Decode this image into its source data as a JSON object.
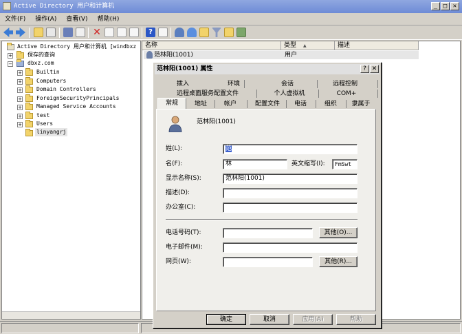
{
  "window": {
    "title": "Active Directory 用户和计算机"
  },
  "menu": [
    "文件(F)",
    "操作(A)",
    "查看(V)",
    "帮助(H)"
  ],
  "tree": {
    "root": "Active Directory 用户和计算机 [windbxz",
    "saved_queries": "保存的查询",
    "domain": "dbxz.com",
    "items": [
      "Builtin",
      "Computers",
      "Domain Controllers",
      "ForeignSecurityPrincipals",
      "Managed Service Accounts",
      "test",
      "Users",
      "linyangrj"
    ]
  },
  "list": {
    "columns": [
      "名称",
      "类型",
      "描述"
    ],
    "sort_arrow": "▲",
    "rows": [
      {
        "name": "范林阳(1001)",
        "type": "用户",
        "desc": ""
      }
    ]
  },
  "dialog": {
    "title": "范林阳(1001) 属性",
    "help_btn": "?",
    "close_btn": "✕",
    "tabs_row1": [
      "拨入",
      "环境",
      "会话",
      "远程控制"
    ],
    "tabs_row2": [
      "远程桌面服务配置文件",
      "个人虚拟机",
      "COM+"
    ],
    "tabs_row3": [
      "常规",
      "地址",
      "帐户",
      "配置文件",
      "电话",
      "组织",
      "隶属于"
    ],
    "display_header": "范林阳(1001)",
    "fields": {
      "surname_label": "姓(L):",
      "surname_value": "范",
      "given_label": "名(F):",
      "given_value": "林",
      "initials_label": "英文缩写(I):",
      "initials_value": "FmSwt",
      "display_label": "显示名称(S):",
      "display_value": "范林阳(1001)",
      "desc_label": "描述(D):",
      "desc_value": "",
      "office_label": "办公室(C):",
      "office_value": "",
      "phone_label": "电话号码(T):",
      "phone_value": "",
      "email_label": "电子邮件(M):",
      "email_value": "",
      "web_label": "网页(W):",
      "web_value": "",
      "other_phone_btn": "其他(O)...",
      "other_web_btn": "其他(R)..."
    },
    "buttons": {
      "ok": "确定",
      "cancel": "取消",
      "apply": "应用(A)",
      "help": "帮助"
    }
  },
  "colors": {
    "title_bar": "#6e8bd6",
    "selection": "#e6e6e6",
    "folder": "#f2d36a"
  }
}
